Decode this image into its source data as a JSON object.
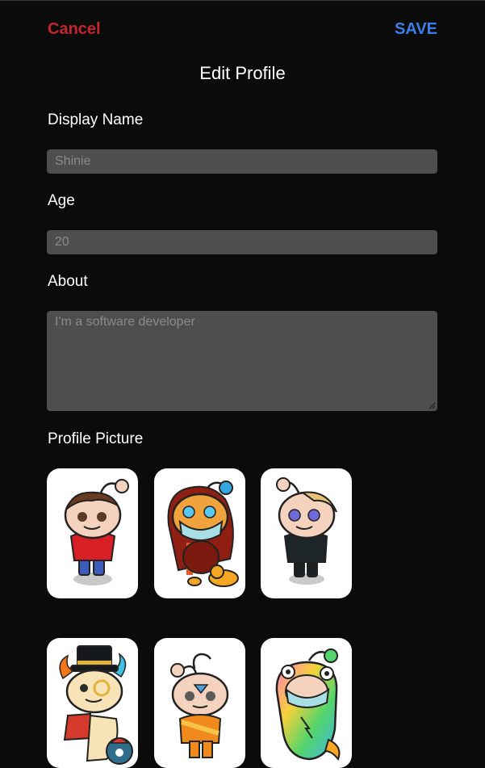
{
  "header": {
    "cancel_label": "Cancel",
    "save_label": "SAVE",
    "title": "Edit Profile"
  },
  "form": {
    "display_name": {
      "label": "Display Name",
      "placeholder": "Shinie"
    },
    "age": {
      "label": "Age",
      "placeholder": "20"
    },
    "about": {
      "label": "About",
      "placeholder": "I'm a software developer"
    },
    "profile_picture": {
      "label": "Profile Picture"
    }
  },
  "avatars": [
    {
      "icon": "snoo-red-shirt-icon"
    },
    {
      "icon": "snoo-lion-mask-icon"
    },
    {
      "icon": "snoo-blonde-icon"
    },
    {
      "icon": "snoo-top-hat-fire-icon"
    },
    {
      "icon": "snoo-orange-monk-icon"
    },
    {
      "icon": "snoo-rainbow-lizard-icon"
    }
  ],
  "colors": {
    "background": "#0b0b0b",
    "cancel": "#c4252d",
    "save": "#3b7fe8",
    "field": "#4e4e4e"
  }
}
